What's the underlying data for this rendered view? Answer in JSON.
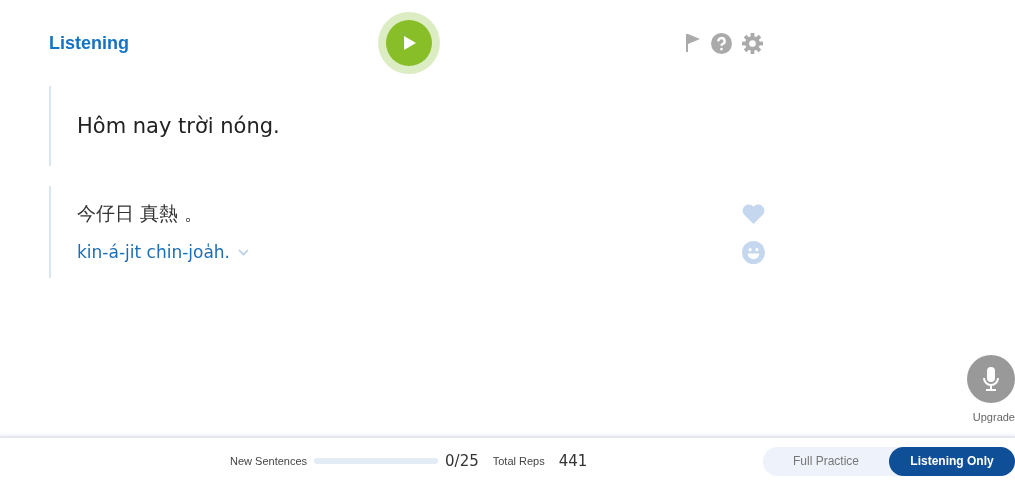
{
  "header": {
    "title": "Listening"
  },
  "prompt": {
    "text": "Hôm nay trời nóng."
  },
  "answer": {
    "characters": "今仔日 真熱 。",
    "romanization": "kin-á-jit chin-joa̍h.",
    "expanded": false
  },
  "mic": {
    "label": "Upgrade"
  },
  "footer": {
    "new_sentences_label": "New Sentences",
    "level": 0,
    "count": "0/25",
    "total_reps_label": "Total Reps",
    "total_reps": "441",
    "modes": [
      {
        "label": "Full Practice",
        "selected": false
      },
      {
        "label": "Listening Only",
        "selected": true
      }
    ]
  }
}
